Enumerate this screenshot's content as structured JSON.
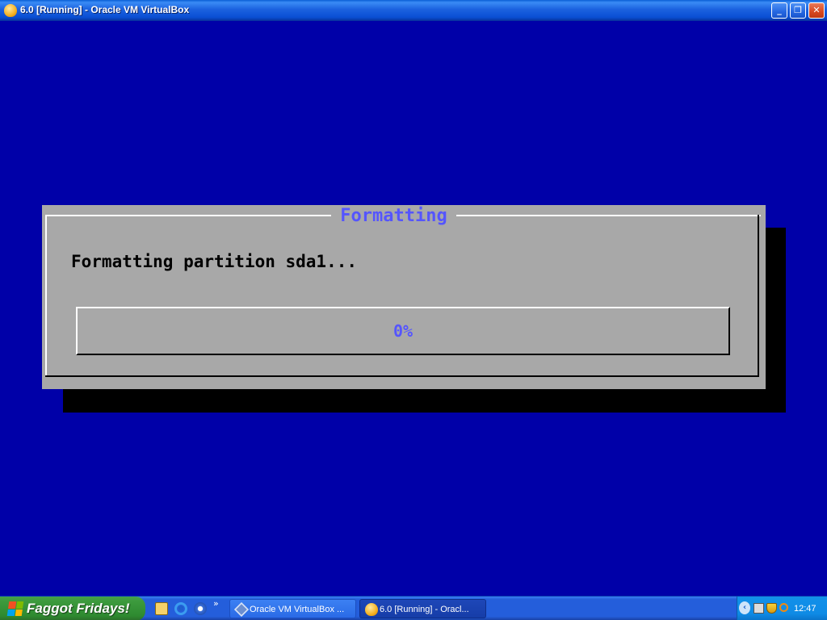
{
  "window": {
    "title": "6.0 [Running] - Oracle VM VirtualBox",
    "icon": "virtualbox-vm-icon",
    "controls": [
      "minimize-icon",
      "restore-icon",
      "close-icon"
    ]
  },
  "dialog": {
    "title": "Formatting",
    "message": "Formatting partition sda1...",
    "progress": {
      "percent": 0,
      "label": "0%"
    }
  },
  "taskbar": {
    "start_label": "Faggot Fridays!",
    "quick_launch": [
      "explorer-icon",
      "internet-explorer-icon",
      "media-player-icon"
    ],
    "quick_launch_more": "»",
    "tasks": [
      {
        "label": "Oracle VM VirtualBox ...",
        "icon": "virtualbox-icon"
      },
      {
        "label": "6.0 [Running] - Oracl...",
        "icon": "vm-window-icon"
      }
    ],
    "tray": {
      "icons": [
        "network-icon",
        "security-shield-icon",
        "search-icon"
      ],
      "clock": "12:47 PM"
    }
  },
  "colors": {
    "screen_bg": "#0000a8",
    "dialog_bg": "#a8a8a8",
    "dialog_title": "#5555ff",
    "start_button": "#3c9a3d",
    "taskbar": "#245edb"
  }
}
